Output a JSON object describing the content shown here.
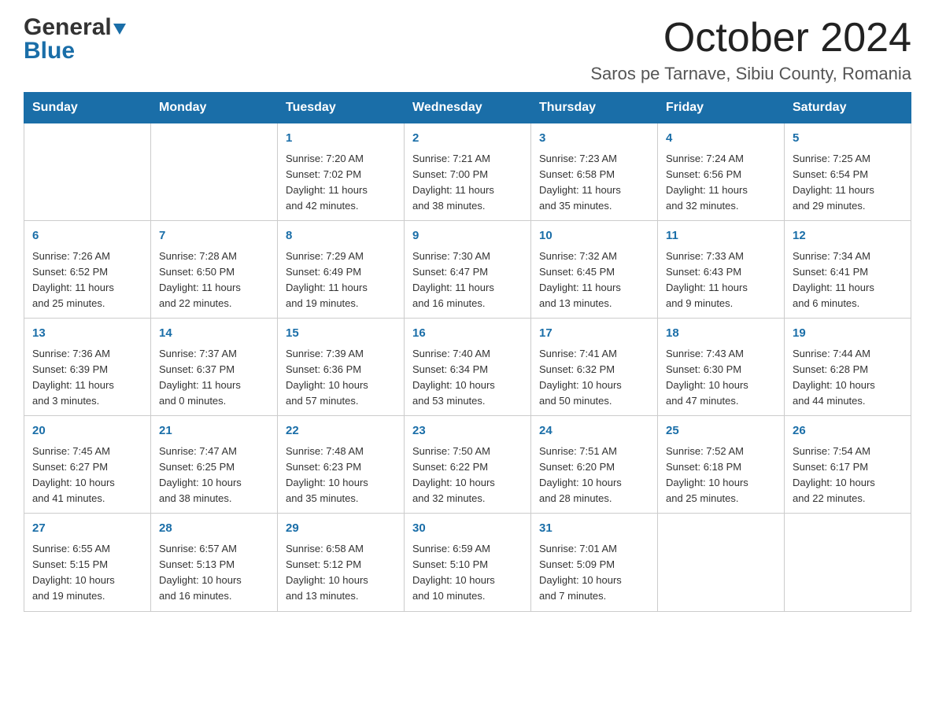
{
  "header": {
    "logo_text1": "General",
    "logo_text2": "Blue",
    "month_title": "October 2024",
    "location": "Saros pe Tarnave, Sibiu County, Romania"
  },
  "days_of_week": [
    "Sunday",
    "Monday",
    "Tuesday",
    "Wednesday",
    "Thursday",
    "Friday",
    "Saturday"
  ],
  "weeks": [
    [
      {
        "day": "",
        "info": ""
      },
      {
        "day": "",
        "info": ""
      },
      {
        "day": "1",
        "info": "Sunrise: 7:20 AM\nSunset: 7:02 PM\nDaylight: 11 hours\nand 42 minutes."
      },
      {
        "day": "2",
        "info": "Sunrise: 7:21 AM\nSunset: 7:00 PM\nDaylight: 11 hours\nand 38 minutes."
      },
      {
        "day": "3",
        "info": "Sunrise: 7:23 AM\nSunset: 6:58 PM\nDaylight: 11 hours\nand 35 minutes."
      },
      {
        "day": "4",
        "info": "Sunrise: 7:24 AM\nSunset: 6:56 PM\nDaylight: 11 hours\nand 32 minutes."
      },
      {
        "day": "5",
        "info": "Sunrise: 7:25 AM\nSunset: 6:54 PM\nDaylight: 11 hours\nand 29 minutes."
      }
    ],
    [
      {
        "day": "6",
        "info": "Sunrise: 7:26 AM\nSunset: 6:52 PM\nDaylight: 11 hours\nand 25 minutes."
      },
      {
        "day": "7",
        "info": "Sunrise: 7:28 AM\nSunset: 6:50 PM\nDaylight: 11 hours\nand 22 minutes."
      },
      {
        "day": "8",
        "info": "Sunrise: 7:29 AM\nSunset: 6:49 PM\nDaylight: 11 hours\nand 19 minutes."
      },
      {
        "day": "9",
        "info": "Sunrise: 7:30 AM\nSunset: 6:47 PM\nDaylight: 11 hours\nand 16 minutes."
      },
      {
        "day": "10",
        "info": "Sunrise: 7:32 AM\nSunset: 6:45 PM\nDaylight: 11 hours\nand 13 minutes."
      },
      {
        "day": "11",
        "info": "Sunrise: 7:33 AM\nSunset: 6:43 PM\nDaylight: 11 hours\nand 9 minutes."
      },
      {
        "day": "12",
        "info": "Sunrise: 7:34 AM\nSunset: 6:41 PM\nDaylight: 11 hours\nand 6 minutes."
      }
    ],
    [
      {
        "day": "13",
        "info": "Sunrise: 7:36 AM\nSunset: 6:39 PM\nDaylight: 11 hours\nand 3 minutes."
      },
      {
        "day": "14",
        "info": "Sunrise: 7:37 AM\nSunset: 6:37 PM\nDaylight: 11 hours\nand 0 minutes."
      },
      {
        "day": "15",
        "info": "Sunrise: 7:39 AM\nSunset: 6:36 PM\nDaylight: 10 hours\nand 57 minutes."
      },
      {
        "day": "16",
        "info": "Sunrise: 7:40 AM\nSunset: 6:34 PM\nDaylight: 10 hours\nand 53 minutes."
      },
      {
        "day": "17",
        "info": "Sunrise: 7:41 AM\nSunset: 6:32 PM\nDaylight: 10 hours\nand 50 minutes."
      },
      {
        "day": "18",
        "info": "Sunrise: 7:43 AM\nSunset: 6:30 PM\nDaylight: 10 hours\nand 47 minutes."
      },
      {
        "day": "19",
        "info": "Sunrise: 7:44 AM\nSunset: 6:28 PM\nDaylight: 10 hours\nand 44 minutes."
      }
    ],
    [
      {
        "day": "20",
        "info": "Sunrise: 7:45 AM\nSunset: 6:27 PM\nDaylight: 10 hours\nand 41 minutes."
      },
      {
        "day": "21",
        "info": "Sunrise: 7:47 AM\nSunset: 6:25 PM\nDaylight: 10 hours\nand 38 minutes."
      },
      {
        "day": "22",
        "info": "Sunrise: 7:48 AM\nSunset: 6:23 PM\nDaylight: 10 hours\nand 35 minutes."
      },
      {
        "day": "23",
        "info": "Sunrise: 7:50 AM\nSunset: 6:22 PM\nDaylight: 10 hours\nand 32 minutes."
      },
      {
        "day": "24",
        "info": "Sunrise: 7:51 AM\nSunset: 6:20 PM\nDaylight: 10 hours\nand 28 minutes."
      },
      {
        "day": "25",
        "info": "Sunrise: 7:52 AM\nSunset: 6:18 PM\nDaylight: 10 hours\nand 25 minutes."
      },
      {
        "day": "26",
        "info": "Sunrise: 7:54 AM\nSunset: 6:17 PM\nDaylight: 10 hours\nand 22 minutes."
      }
    ],
    [
      {
        "day": "27",
        "info": "Sunrise: 6:55 AM\nSunset: 5:15 PM\nDaylight: 10 hours\nand 19 minutes."
      },
      {
        "day": "28",
        "info": "Sunrise: 6:57 AM\nSunset: 5:13 PM\nDaylight: 10 hours\nand 16 minutes."
      },
      {
        "day": "29",
        "info": "Sunrise: 6:58 AM\nSunset: 5:12 PM\nDaylight: 10 hours\nand 13 minutes."
      },
      {
        "day": "30",
        "info": "Sunrise: 6:59 AM\nSunset: 5:10 PM\nDaylight: 10 hours\nand 10 minutes."
      },
      {
        "day": "31",
        "info": "Sunrise: 7:01 AM\nSunset: 5:09 PM\nDaylight: 10 hours\nand 7 minutes."
      },
      {
        "day": "",
        "info": ""
      },
      {
        "day": "",
        "info": ""
      }
    ]
  ]
}
